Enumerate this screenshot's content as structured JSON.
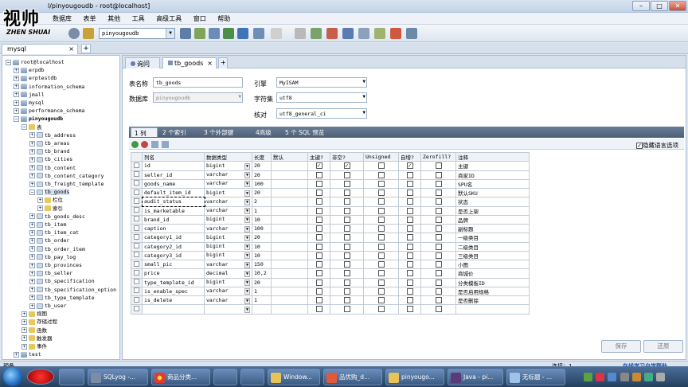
{
  "window": {
    "title": "SQLyog - [pinyougoudb - root@localhost]",
    "title_visible": "l/pinyougoudb - root@localhost]"
  },
  "watermark": {
    "chars": "视帅",
    "sub": "ZHEN SHUAI"
  },
  "menu": [
    "数据库",
    "表单",
    "其他",
    "工具",
    "高级工具",
    "窗口",
    "帮助"
  ],
  "menu_partial": "数据库",
  "db_selector": "pinyougoudb",
  "connection_tab": {
    "label": "mysql"
  },
  "tree": [
    {
      "label": "root@localhost",
      "indent": 0,
      "icon": "db",
      "pm": "−"
    },
    {
      "label": "erpdb",
      "indent": 1,
      "icon": "db",
      "pm": "+"
    },
    {
      "label": "erptestdb",
      "indent": 1,
      "icon": "db",
      "pm": "+"
    },
    {
      "label": "information_schema",
      "indent": 1,
      "icon": "db",
      "pm": "+"
    },
    {
      "label": "jmall",
      "indent": 1,
      "icon": "db",
      "pm": "+"
    },
    {
      "label": "mysql",
      "indent": 1,
      "icon": "db",
      "pm": "+"
    },
    {
      "label": "performance_schema",
      "indent": 1,
      "icon": "db",
      "pm": "+"
    },
    {
      "label": "pinyougoudb",
      "indent": 1,
      "icon": "db",
      "pm": "−",
      "bold": true
    },
    {
      "label": "表",
      "indent": 2,
      "icon": "fd",
      "pm": "−"
    },
    {
      "label": "tb_address",
      "indent": 3,
      "icon": "tbl",
      "pm": "+"
    },
    {
      "label": "tb_areas",
      "indent": 3,
      "icon": "tbl",
      "pm": "+"
    },
    {
      "label": "tb_brand",
      "indent": 3,
      "icon": "tbl",
      "pm": "+"
    },
    {
      "label": "tb_cities",
      "indent": 3,
      "icon": "tbl",
      "pm": "+"
    },
    {
      "label": "tb_content",
      "indent": 3,
      "icon": "tbl",
      "pm": "+"
    },
    {
      "label": "tb_content_category",
      "indent": 3,
      "icon": "tbl",
      "pm": "+"
    },
    {
      "label": "tb_freight_template",
      "indent": 3,
      "icon": "tbl",
      "pm": "+"
    },
    {
      "label": "tb_goods",
      "indent": 3,
      "icon": "tbl",
      "pm": "−"
    },
    {
      "label": "栏位",
      "indent": 4,
      "icon": "fd",
      "pm": "+"
    },
    {
      "label": "索引",
      "indent": 4,
      "icon": "fd",
      "pm": "+"
    },
    {
      "label": "tb_goods_desc",
      "indent": 3,
      "icon": "tbl",
      "pm": "+"
    },
    {
      "label": "tb_item",
      "indent": 3,
      "icon": "tbl",
      "pm": "+"
    },
    {
      "label": "tb_item_cat",
      "indent": 3,
      "icon": "tbl",
      "pm": "+"
    },
    {
      "label": "tb_order",
      "indent": 3,
      "icon": "tbl",
      "pm": "+"
    },
    {
      "label": "tb_order_item",
      "indent": 3,
      "icon": "tbl",
      "pm": "+"
    },
    {
      "label": "tb_pay_log",
      "indent": 3,
      "icon": "tbl",
      "pm": "+"
    },
    {
      "label": "tb_provinces",
      "indent": 3,
      "icon": "tbl",
      "pm": "+"
    },
    {
      "label": "tb_seller",
      "indent": 3,
      "icon": "tbl",
      "pm": "+"
    },
    {
      "label": "tb_specification",
      "indent": 3,
      "icon": "tbl",
      "pm": "+"
    },
    {
      "label": "tb_specification_option",
      "indent": 3,
      "icon": "tbl",
      "pm": "+"
    },
    {
      "label": "tb_type_template",
      "indent": 3,
      "icon": "tbl",
      "pm": "+"
    },
    {
      "label": "tb_user",
      "indent": 3,
      "icon": "tbl",
      "pm": "+"
    },
    {
      "label": "视图",
      "indent": 2,
      "icon": "fd",
      "pm": "+"
    },
    {
      "label": "存储过程",
      "indent": 2,
      "icon": "fd",
      "pm": "+"
    },
    {
      "label": "函数",
      "indent": 2,
      "icon": "fd",
      "pm": "+"
    },
    {
      "label": "触发器",
      "indent": 2,
      "icon": "fd",
      "pm": "+"
    },
    {
      "label": "事件",
      "indent": 2,
      "icon": "fd",
      "pm": "+"
    },
    {
      "label": "test",
      "indent": 1,
      "icon": "db",
      "pm": "+"
    }
  ],
  "subtabs": {
    "query": "询问",
    "table": "tb_goods"
  },
  "form": {
    "table_name_label": "表名称",
    "table_name": "tb_goods",
    "database_label": "数据库",
    "database": "pinyougoudb",
    "engine_label": "引擎",
    "engine": "MyISAM",
    "charset_label": "字符集",
    "charset": "utf8",
    "collation_label": "核对",
    "collation": "utf8_general_ci"
  },
  "column_tabs": [
    "1 列",
    "2 个索引",
    "3 个外部键",
    "4高级",
    "5 个 SQL 预览"
  ],
  "hide_language_option": "隐藏语言选项",
  "grid": {
    "headers": [
      "列名",
      "数据类型",
      "长度",
      "默认",
      "主键?",
      "非空?",
      "Unsigned",
      "自增?",
      "Zerofill?",
      "注释"
    ],
    "rows": [
      {
        "name": "id",
        "type": "bigint",
        "len": "20",
        "def": "",
        "pk": true,
        "nn": true,
        "un": false,
        "ai": true,
        "zf": false,
        "comment": "主键"
      },
      {
        "name": "seller_id",
        "type": "varchar",
        "len": "20",
        "def": "",
        "pk": false,
        "nn": false,
        "un": false,
        "ai": false,
        "zf": false,
        "comment": "商家ID"
      },
      {
        "name": "goods_name",
        "type": "varchar",
        "len": "100",
        "def": "",
        "pk": false,
        "nn": false,
        "un": false,
        "ai": false,
        "zf": false,
        "comment": "SPU名"
      },
      {
        "name": "default_item_id",
        "type": "bigint",
        "len": "20",
        "def": "",
        "pk": false,
        "nn": false,
        "un": false,
        "ai": false,
        "zf": false,
        "comment": "默认SKU"
      },
      {
        "name": "audit_status",
        "type": "varchar",
        "len": "2",
        "def": "",
        "pk": false,
        "nn": false,
        "un": false,
        "ai": false,
        "zf": false,
        "comment": "状态"
      },
      {
        "name": "is_marketable",
        "type": "varchar",
        "len": "1",
        "def": "",
        "pk": false,
        "nn": false,
        "un": false,
        "ai": false,
        "zf": false,
        "comment": "是否上架"
      },
      {
        "name": "brand_id",
        "type": "bigint",
        "len": "10",
        "def": "",
        "pk": false,
        "nn": false,
        "un": false,
        "ai": false,
        "zf": false,
        "comment": "品牌"
      },
      {
        "name": "caption",
        "type": "varchar",
        "len": "100",
        "def": "",
        "pk": false,
        "nn": false,
        "un": false,
        "ai": false,
        "zf": false,
        "comment": "副标题"
      },
      {
        "name": "category1_id",
        "type": "bigint",
        "len": "20",
        "def": "",
        "pk": false,
        "nn": false,
        "un": false,
        "ai": false,
        "zf": false,
        "comment": "一级类目"
      },
      {
        "name": "category2_id",
        "type": "bigint",
        "len": "10",
        "def": "",
        "pk": false,
        "nn": false,
        "un": false,
        "ai": false,
        "zf": false,
        "comment": "二级类目"
      },
      {
        "name": "category3_id",
        "type": "bigint",
        "len": "10",
        "def": "",
        "pk": false,
        "nn": false,
        "un": false,
        "ai": false,
        "zf": false,
        "comment": "三级类目"
      },
      {
        "name": "small_pic",
        "type": "varchar",
        "len": "150",
        "def": "",
        "pk": false,
        "nn": false,
        "un": false,
        "ai": false,
        "zf": false,
        "comment": "小图"
      },
      {
        "name": "price",
        "type": "decimal",
        "len": "10,2",
        "def": "",
        "pk": false,
        "nn": false,
        "un": false,
        "ai": false,
        "zf": false,
        "comment": "商城价"
      },
      {
        "name": "type_template_id",
        "type": "bigint",
        "len": "20",
        "def": "",
        "pk": false,
        "nn": false,
        "un": false,
        "ai": false,
        "zf": false,
        "comment": "分类模板ID"
      },
      {
        "name": "is_enable_spec",
        "type": "varchar",
        "len": "1",
        "def": "",
        "pk": false,
        "nn": false,
        "un": false,
        "ai": false,
        "zf": false,
        "comment": "是否启用规格"
      },
      {
        "name": "is_delete",
        "type": "varchar",
        "len": "1",
        "def": "",
        "pk": false,
        "nn": false,
        "un": false,
        "ai": false,
        "zf": false,
        "comment": "是否删除"
      },
      {
        "name": "",
        "type": "",
        "len": "",
        "def": "",
        "pk": false,
        "nn": false,
        "un": false,
        "ai": false,
        "zf": false,
        "comment": ""
      }
    ]
  },
  "buttons": {
    "save": "保存",
    "revert": "还原"
  },
  "status": {
    "left": "预备",
    "right": "连接：1",
    "corner": "在线学习自学帮助"
  },
  "taskbar": [
    {
      "label": "SQLyog -..."
    },
    {
      "label": "商品分类..."
    },
    {
      "label": "Window..."
    },
    {
      "label": "品优购_d..."
    },
    {
      "label": "pinyougo..."
    },
    {
      "label": "Java - pi..."
    },
    {
      "label": "无标题 - ..."
    }
  ],
  "colors": {
    "accent": "#4d5e77",
    "taskbar": "#23405f"
  }
}
